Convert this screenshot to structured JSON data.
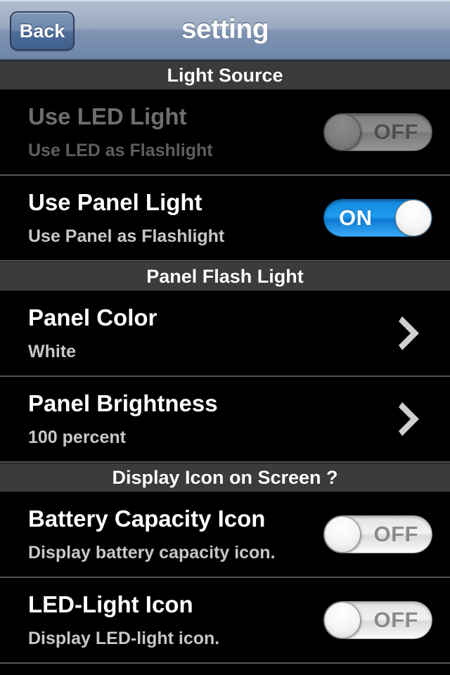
{
  "navbar": {
    "title": "setting",
    "back_label": "Back",
    "back_icon": "back-button",
    "gradient_top": "#c3cddc",
    "gradient_bottom": "#6d86a9"
  },
  "theme": {
    "background": "#000000",
    "section_header_bg": "#3b3b3b",
    "title_color": "#ffffff",
    "subtitle_color": "#c7c7c7",
    "disabled_title_color": "#6e6e6e",
    "separator_color": "#555555",
    "switch_on_color": "#1f9cf0",
    "chevron_color": "#cfcfcf"
  },
  "sections": [
    {
      "header": "Light Source",
      "rows": [
        {
          "title": "Use LED Light",
          "subtitle": "Use LED as Flashlight",
          "control": "switch",
          "state": "OFF",
          "state_label": "OFF",
          "enabled": false
        },
        {
          "title": "Use Panel Light",
          "subtitle": "Use Panel as Flashlight",
          "control": "switch",
          "state": "ON",
          "state_label": "ON",
          "enabled": true
        }
      ]
    },
    {
      "header": "Panel Flash Light",
      "rows": [
        {
          "title": "Panel Color",
          "subtitle": "White",
          "control": "disclosure",
          "icon": "chevron-right-icon"
        },
        {
          "title": "Panel Brightness",
          "subtitle": "100 percent",
          "control": "disclosure",
          "icon": "chevron-right-icon"
        }
      ]
    },
    {
      "header": "Display Icon on Screen ?",
      "rows": [
        {
          "title": "Battery Capacity Icon",
          "subtitle": "Display battery capacity icon.",
          "control": "switch",
          "state": "OFF",
          "state_label": "OFF",
          "enabled": true
        },
        {
          "title": "LED-Light Icon",
          "subtitle": "Display LED-light icon.",
          "control": "switch",
          "state": "OFF",
          "state_label": "OFF",
          "enabled": true
        }
      ]
    }
  ]
}
